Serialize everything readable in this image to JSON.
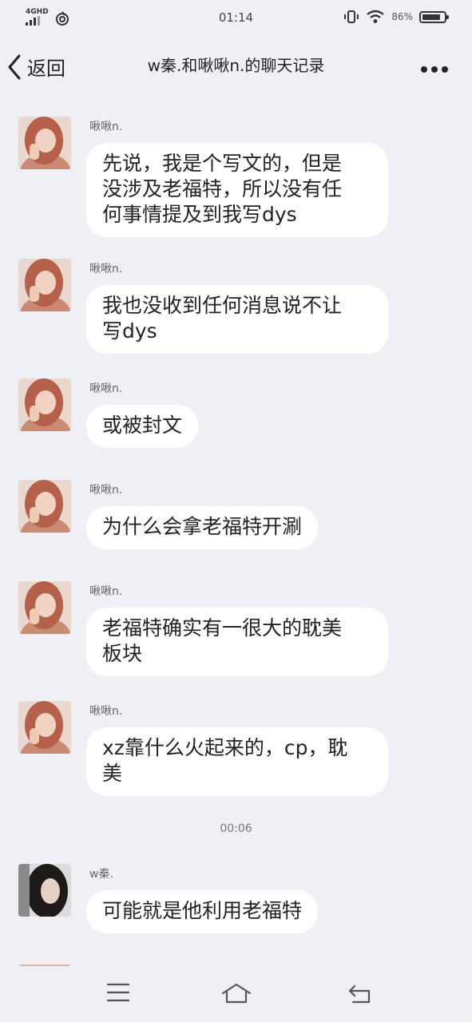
{
  "status_bar": {
    "network": "4GHD",
    "time": "01:14",
    "battery_percent": "86%",
    "battery_level": 0.86
  },
  "header": {
    "back_label": "返回",
    "title": "w秦.和啾啾n.的聊天记录"
  },
  "messages": [
    {
      "sender": "啾啾n.",
      "avatar": "avatar-woman-pink",
      "text": "先说，我是个写文的，但是\n没涉及老福特，所以没有任\n何事情提及到我写dys"
    },
    {
      "sender": "啾啾n.",
      "avatar": "avatar-woman-pink",
      "text": "我也没收到任何消息说不让\n写dys"
    },
    {
      "sender": "啾啾n.",
      "avatar": "avatar-woman-pink",
      "text": "或被封文"
    },
    {
      "sender": "啾啾n.",
      "avatar": "avatar-woman-pink",
      "text": "为什么会拿老福特开涮"
    },
    {
      "sender": "啾啾n.",
      "avatar": "avatar-woman-pink",
      "text": "老福特确实有一很大的耽美\n板块"
    },
    {
      "sender": "啾啾n.",
      "avatar": "avatar-woman-pink",
      "text": "xz靠什么火起来的，cp，耽\n美"
    },
    {
      "sender": "w秦.",
      "avatar": "avatar-dark-hair",
      "text": "可能就是他利用老福特"
    }
  ],
  "timestamp": "00:06",
  "bottom_nav": {
    "menu_icon": "menu-icon",
    "home_icon": "home-icon",
    "back_icon": "back-icon"
  }
}
